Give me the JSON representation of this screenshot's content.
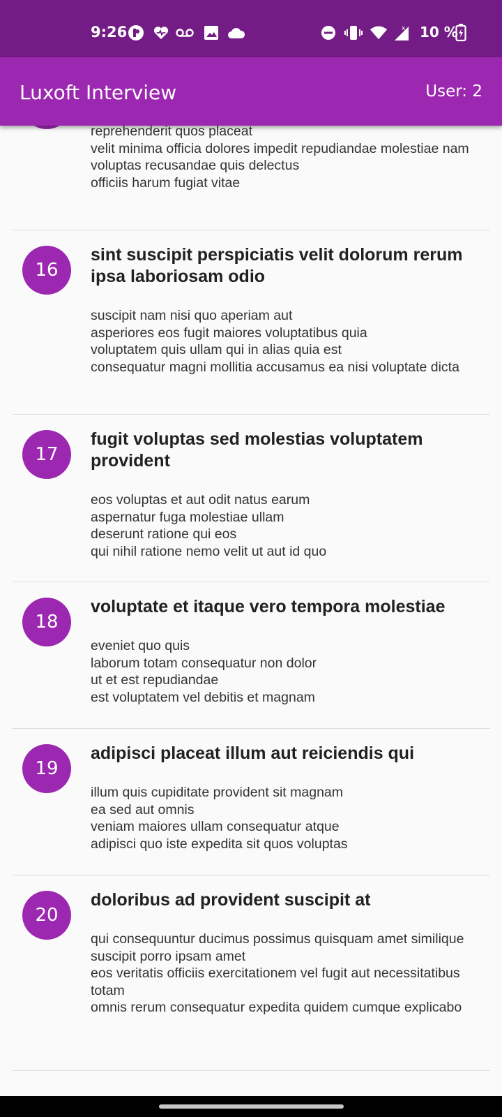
{
  "status_bar": {
    "time": "9:26",
    "battery": "10 %",
    "icons_left": [
      "app-badge-icon",
      "health-heart-icon",
      "voicemail-icon",
      "image-icon",
      "cloud-icon"
    ],
    "icons_right": [
      "do-not-disturb-icon",
      "vibrate-icon",
      "wifi-icon",
      "cell-signal-icon",
      "battery-charging-icon"
    ]
  },
  "app_bar": {
    "title": "Luxoft Interview",
    "user": "User: 2"
  },
  "partial_item": {
    "body": "reprehenderit quos placeat\nvelit minima officia dolores impedit repudiandae molestiae nam\nvoluptas recusandae quis delectus\nofficiis harum fugiat vitae"
  },
  "posts": [
    {
      "id": "16",
      "title": "sint suscipit perspiciatis velit dolorum rerum ipsa laboriosam odio",
      "body": "suscipit nam nisi quo aperiam aut\nasperiores eos fugit maiores voluptatibus quia\nvoluptatem quis ullam qui in alias quia est\nconsequatur magni mollitia accusamus ea nisi voluptate dicta"
    },
    {
      "id": "17",
      "title": "fugit voluptas sed molestias voluptatem provident",
      "body": "eos voluptas et aut odit natus earum\naspernatur fuga molestiae ullam\ndeserunt ratione qui eos\nqui nihil ratione nemo velit ut aut id quo"
    },
    {
      "id": "18",
      "title": "voluptate et itaque vero tempora molestiae",
      "body": "eveniet quo quis\nlaborum totam consequatur non dolor\nut et est repudiandae\nest voluptatem vel debitis et magnam"
    },
    {
      "id": "19",
      "title": "adipisci placeat illum aut reiciendis qui",
      "body": "illum quis cupiditate provident sit magnam\nea sed aut omnis\nveniam maiores ullam consequatur atque\nadipisci quo iste expedita sit quos voluptas"
    },
    {
      "id": "20",
      "title": "doloribus ad provident suscipit at",
      "body": "qui consequuntur ducimus possimus quisquam amet similique\nsuscipit porro ipsam amet\neos veritatis officiis exercitationem vel fugit aut necessitatibus totam\nomnis rerum consequatur expedita quidem cumque explicabo"
    }
  ],
  "colors": {
    "status_bar": "#741c86",
    "app_bar": "#9c27b0",
    "avatar": "#9c27b0"
  }
}
